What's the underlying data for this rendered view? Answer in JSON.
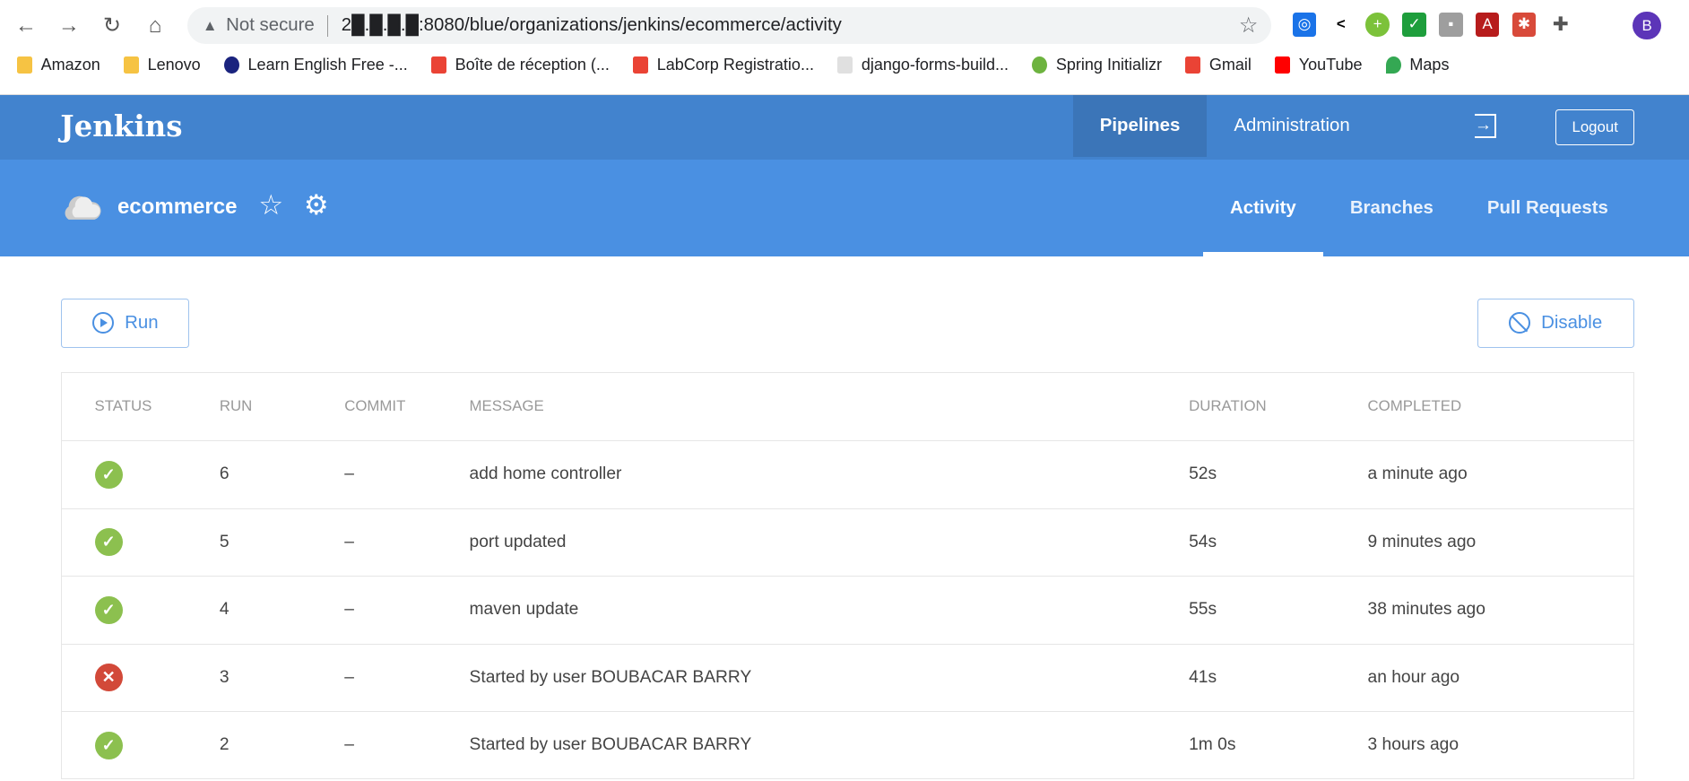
{
  "browser": {
    "security": "Not secure",
    "url": "2█.█.█.█:8080/blue/organizations/jenkins/ecommerce/activity",
    "profile_initial": "B",
    "bookmarks": [
      {
        "label": "Amazon",
        "color": "#f6c343"
      },
      {
        "label": "Lenovo",
        "color": "#f6c343"
      },
      {
        "label": "Learn English Free -...",
        "color": "#1a237e"
      },
      {
        "label": "Boîte de réception (...",
        "color": "#ea4335"
      },
      {
        "label": "LabCorp Registratio...",
        "color": "#ea4335"
      },
      {
        "label": "django-forms-build...",
        "color": "#e0e0e0"
      },
      {
        "label": "Spring Initializr",
        "color": "#6db33f"
      },
      {
        "label": "Gmail",
        "color": "#ea4335"
      },
      {
        "label": "YouTube",
        "color": "#ff0000"
      },
      {
        "label": "Maps",
        "color": "#34a853"
      }
    ]
  },
  "header": {
    "logo": "Jenkins",
    "nav": [
      "Pipelines",
      "Administration"
    ],
    "logout": "Logout"
  },
  "pipeline": {
    "name": "ecommerce",
    "tabs": [
      "Activity",
      "Branches",
      "Pull Requests"
    ]
  },
  "actions": {
    "run": "Run",
    "disable": "Disable"
  },
  "table": {
    "columns": [
      "STATUS",
      "RUN",
      "COMMIT",
      "MESSAGE",
      "DURATION",
      "COMPLETED"
    ],
    "rows": [
      {
        "status": "success",
        "run": "6",
        "commit": "–",
        "message": "add home controller",
        "duration": "52s",
        "completed": "a minute ago"
      },
      {
        "status": "success",
        "run": "5",
        "commit": "–",
        "message": "port updated",
        "duration": "54s",
        "completed": "9 minutes ago"
      },
      {
        "status": "success",
        "run": "4",
        "commit": "–",
        "message": "maven update",
        "duration": "55s",
        "completed": "38 minutes ago"
      },
      {
        "status": "failure",
        "run": "3",
        "commit": "–",
        "message": "Started by user BOUBACAR BARRY",
        "duration": "41s",
        "completed": "an hour ago"
      },
      {
        "status": "success",
        "run": "2",
        "commit": "–",
        "message": "Started by user BOUBACAR BARRY",
        "duration": "1m 0s",
        "completed": "3 hours ago"
      }
    ]
  }
}
